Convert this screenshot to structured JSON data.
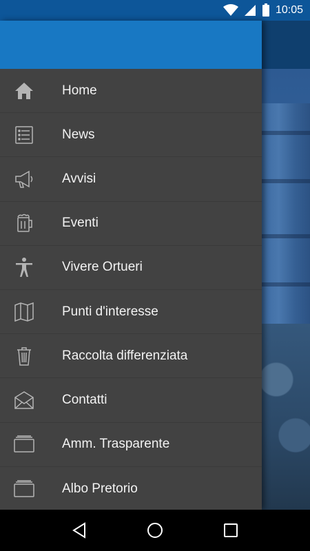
{
  "status_bar": {
    "time": "10:05",
    "icons": [
      "wifi-icon",
      "signal-icon",
      "battery-icon"
    ]
  },
  "drawer": {
    "menu_items": [
      {
        "label": "Home",
        "icon": "home-icon"
      },
      {
        "label": "News",
        "icon": "list-icon"
      },
      {
        "label": "Avvisi",
        "icon": "megaphone-icon"
      },
      {
        "label": "Eventi",
        "icon": "beer-mug-icon"
      },
      {
        "label": "Vivere Ortueri",
        "icon": "person-icon"
      },
      {
        "label": "Punti d'interesse",
        "icon": "map-icon"
      },
      {
        "label": "Raccolta differenziata",
        "icon": "trash-icon"
      },
      {
        "label": "Contatti",
        "icon": "envelope-icon"
      },
      {
        "label": "Amm. Trasparente",
        "icon": "folder-icon"
      },
      {
        "label": "Albo Pretorio",
        "icon": "folder-icon"
      }
    ]
  },
  "nav_bar": {
    "buttons": [
      "back-icon",
      "home-circle-icon",
      "recents-icon"
    ]
  },
  "colors": {
    "status_bar": "#0d5699",
    "drawer_header": "#1878c3",
    "drawer_bg": "#424242",
    "menu_text": "#f2f2f2",
    "icon": "#b5b5b5"
  }
}
